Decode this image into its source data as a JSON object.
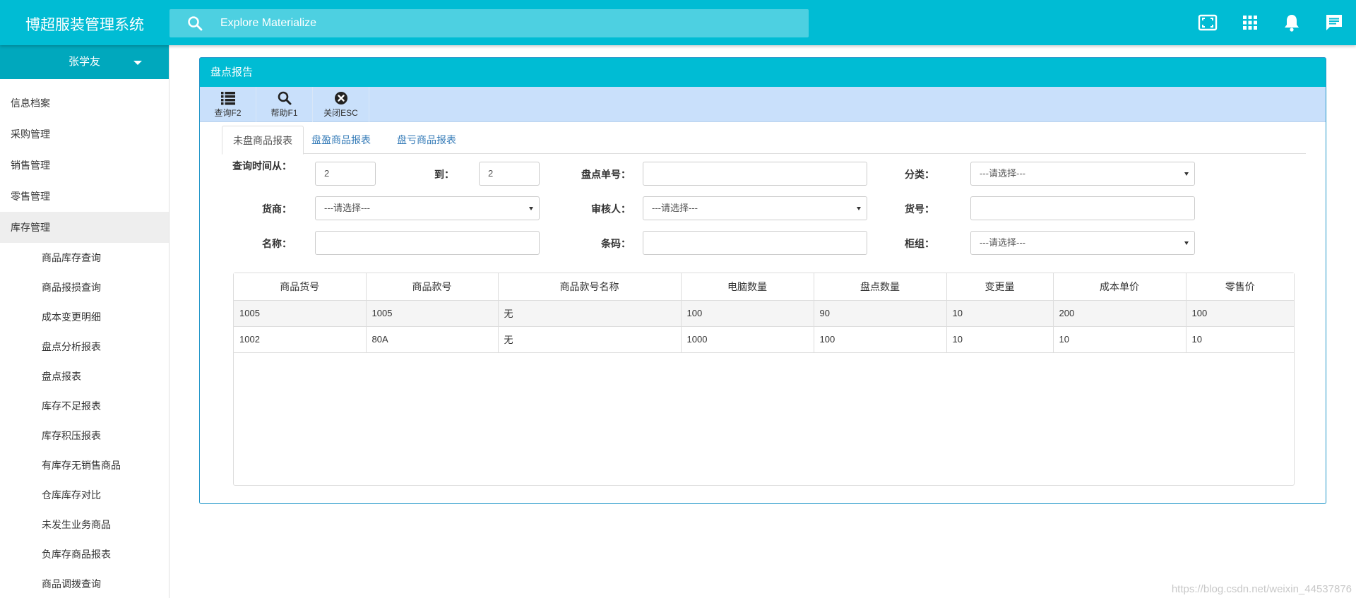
{
  "app": {
    "title": "博超服装管理系统"
  },
  "search": {
    "placeholder": "Explore Materialize"
  },
  "top_icons": [
    "fullscreen-icon",
    "apps-grid-icon",
    "bell-icon",
    "chat-icon"
  ],
  "user": {
    "name": "张学友"
  },
  "sidebar": {
    "items": [
      {
        "label": "信息档案"
      },
      {
        "label": "采购管理"
      },
      {
        "label": "销售管理"
      },
      {
        "label": "零售管理"
      },
      {
        "label": "库存管理",
        "active": true
      }
    ],
    "subitems": [
      {
        "label": "商品库存查询"
      },
      {
        "label": "商品报损查询"
      },
      {
        "label": "成本变更明细"
      },
      {
        "label": "盘点分析报表"
      },
      {
        "label": "盘点报表"
      },
      {
        "label": "库存不足报表"
      },
      {
        "label": "库存积压报表"
      },
      {
        "label": "有库存无销售商品"
      },
      {
        "label": "仓库库存对比"
      },
      {
        "label": "未发生业务商品"
      },
      {
        "label": "负库存商品报表"
      },
      {
        "label": "商品调拨查询"
      }
    ]
  },
  "panel": {
    "title": "盘点报告"
  },
  "toolbar": {
    "query_label": "查询F2",
    "help_label": "帮助F1",
    "close_label": "关闭ESC"
  },
  "tabs": [
    {
      "label": "未盘商品报表",
      "active": true
    },
    {
      "label": "盘盈商品报表"
    },
    {
      "label": "盘亏商品报表"
    }
  ],
  "form": {
    "query_from_label": "查询时间从：",
    "query_from_value": "2",
    "to_label": "到：",
    "to_value": "2",
    "inventory_no_label": "盘点单号：",
    "inventory_no_value": "",
    "category_label": "分类：",
    "category_value": "---请选择---",
    "supplier_label": "货商：",
    "supplier_value": "---请选择---",
    "reviewer_label": "审核人：",
    "reviewer_value": "---请选择---",
    "item_no_label": "货号：",
    "item_no_value": "",
    "name_label": "名称：",
    "name_value": "",
    "barcode_label": "条码：",
    "barcode_value": "",
    "counter_label": "柜组：",
    "counter_value": "---请选择---"
  },
  "table": {
    "columns": [
      "商品货号",
      "商品款号",
      "商品款号名称",
      "电脑数量",
      "盘点数量",
      "变更量",
      "成本单价",
      "零售价"
    ],
    "rows": [
      [
        "1005",
        "1005",
        "无",
        "100",
        "90",
        "10",
        "200",
        "100"
      ],
      [
        "1002",
        "80A",
        "无",
        "1000",
        "100",
        "10",
        "10",
        "10"
      ]
    ]
  },
  "watermark": "https://blog.csdn.net/weixin_44537876",
  "colors": {
    "primary": "#00bcd4",
    "toolbar": "#c9e0fb",
    "link": "#337ab7"
  }
}
